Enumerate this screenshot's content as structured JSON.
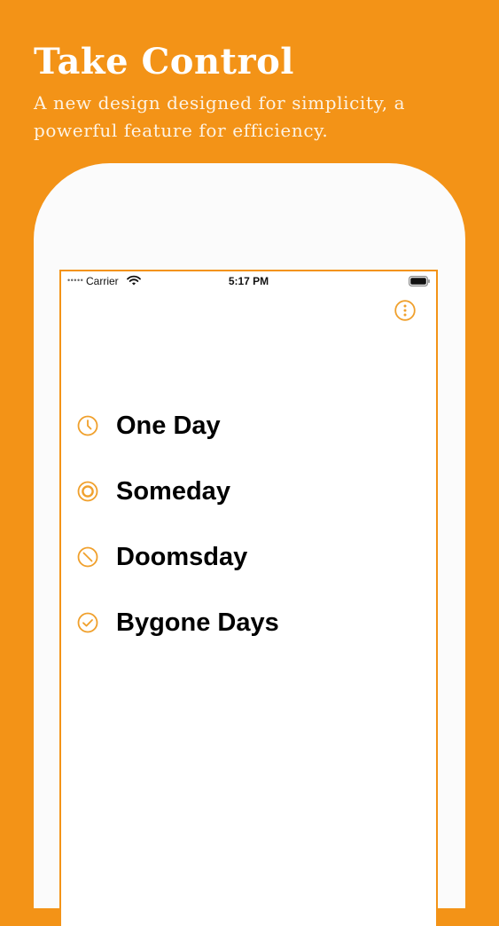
{
  "promo": {
    "headline": "Take Control",
    "subhead": "A new design designed for simplicity, a powerful feature for efficiency."
  },
  "colors": {
    "accent": "#f39317",
    "icon": "#f0a02c",
    "background": "#f39317",
    "screen": "#ffffff"
  },
  "status_bar": {
    "carrier": "Carrier",
    "time": "5:17 PM",
    "signal": "•••••",
    "wifi_icon": "wifi-icon",
    "battery_icon": "battery-icon"
  },
  "toolbar": {
    "menu_icon": "more-options-icon"
  },
  "categories": [
    {
      "label": "One Day",
      "icon": "clock-icon"
    },
    {
      "label": "Someday",
      "icon": "target-icon"
    },
    {
      "label": "Doomsday",
      "icon": "prohibited-icon"
    },
    {
      "label": "Bygone Days",
      "icon": "checkmark-circle-icon"
    }
  ]
}
